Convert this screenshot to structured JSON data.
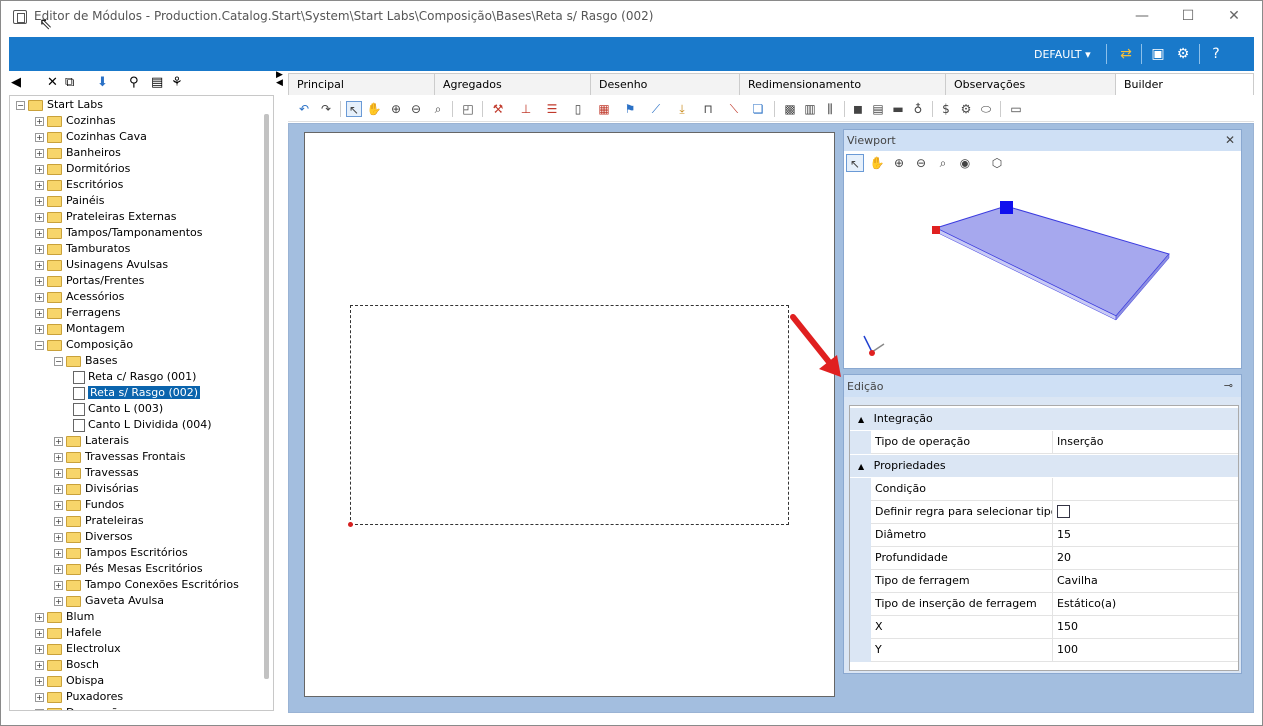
{
  "window": {
    "title": "Editor de Módulos - Production.Catalog.Start\\System\\Start Labs\\Composição\\Bases\\Reta s/ Rasgo (002)",
    "minimize": "—",
    "maximize": "☐",
    "close": "✕"
  },
  "topbar": {
    "profile_label": "DEFAULT",
    "dropdown_arrow": "▾",
    "accent_color": "#1979ca"
  },
  "tree": {
    "items": [
      {
        "label": "Start Labs",
        "type": "folder",
        "expander": "−"
      },
      {
        "label": "Cozinhas",
        "type": "folder",
        "expander": "+"
      },
      {
        "label": "Cozinhas Cava",
        "type": "folder",
        "expander": "+"
      },
      {
        "label": "Banheiros",
        "type": "folder",
        "expander": "+"
      },
      {
        "label": "Dormitórios",
        "type": "folder",
        "expander": "+"
      },
      {
        "label": "Escritórios",
        "type": "folder",
        "expander": "+"
      },
      {
        "label": "Painéis",
        "type": "folder",
        "expander": "+"
      },
      {
        "label": "Prateleiras Externas",
        "type": "folder",
        "expander": "+"
      },
      {
        "label": "Tampos/Tamponamentos",
        "type": "folder",
        "expander": "+"
      },
      {
        "label": "Tamburatos",
        "type": "folder",
        "expander": "+"
      },
      {
        "label": "Usinagens Avulsas",
        "type": "folder",
        "expander": "+"
      },
      {
        "label": "Portas/Frentes",
        "type": "folder",
        "expander": "+"
      },
      {
        "label": "Acessórios",
        "type": "folder",
        "expander": "+"
      },
      {
        "label": "Ferragens",
        "type": "folder",
        "expander": "+"
      },
      {
        "label": "Montagem",
        "type": "folder",
        "expander": "+"
      },
      {
        "label": "Composição",
        "type": "folder",
        "expander": "−"
      },
      {
        "label": "Bases",
        "type": "folder",
        "expander": "−"
      },
      {
        "label": "Reta c/ Rasgo (001)",
        "type": "doc",
        "expander": ""
      },
      {
        "label": "Reta s/ Rasgo (002)",
        "type": "doc",
        "expander": "",
        "selected": true
      },
      {
        "label": "Canto L (003)",
        "type": "doc",
        "expander": ""
      },
      {
        "label": "Canto L Dividida (004)",
        "type": "doc",
        "expander": ""
      },
      {
        "label": "Laterais",
        "type": "folder",
        "expander": "+"
      },
      {
        "label": "Travessas Frontais",
        "type": "folder",
        "expander": "+"
      },
      {
        "label": "Travessas",
        "type": "folder",
        "expander": "+"
      },
      {
        "label": "Divisórias",
        "type": "folder",
        "expander": "+"
      },
      {
        "label": "Fundos",
        "type": "folder",
        "expander": "+"
      },
      {
        "label": "Prateleiras",
        "type": "folder",
        "expander": "+"
      },
      {
        "label": "Diversos",
        "type": "folder",
        "expander": "+"
      },
      {
        "label": "Tampos Escritórios",
        "type": "folder",
        "expander": "+"
      },
      {
        "label": "Pés Mesas Escritórios",
        "type": "folder",
        "expander": "+"
      },
      {
        "label": "Tampo Conexões Escritórios",
        "type": "folder",
        "expander": "+"
      },
      {
        "label": "Gaveta Avulsa",
        "type": "folder",
        "expander": "+"
      },
      {
        "label": "Blum",
        "type": "folder",
        "expander": "+"
      },
      {
        "label": "Hafele",
        "type": "folder",
        "expander": "+"
      },
      {
        "label": "Electrolux",
        "type": "folder",
        "expander": "+"
      },
      {
        "label": "Bosch",
        "type": "folder",
        "expander": "+"
      },
      {
        "label": "Obispa",
        "type": "folder",
        "expander": "+"
      },
      {
        "label": "Puxadores",
        "type": "folder",
        "expander": "+"
      },
      {
        "label": "Decoração",
        "type": "folder",
        "expander": "+"
      }
    ]
  },
  "tabs": [
    {
      "label": "Principal",
      "active": false
    },
    {
      "label": "Agregados",
      "active": false
    },
    {
      "label": "Desenho",
      "active": false
    },
    {
      "label": "Redimensionamento",
      "active": false
    },
    {
      "label": "Observações",
      "active": false
    },
    {
      "label": "Builder",
      "active": true
    }
  ],
  "viewport": {
    "title": "Viewport",
    "close": "✕"
  },
  "edicao": {
    "title": "Edição",
    "pin": "📌",
    "categories": [
      {
        "label": "Integração",
        "toggle": "▲"
      },
      {
        "label": "Propriedades",
        "toggle": "▲"
      }
    ],
    "rows": [
      {
        "name": "Tipo de operação",
        "value": "Inserção"
      },
      {
        "name": "Condição",
        "value": ""
      },
      {
        "name": "Definir regra para selecionar tipo...",
        "value": "",
        "checkbox": true
      },
      {
        "name": "Diâmetro",
        "value": "15"
      },
      {
        "name": "Profundidade",
        "value": "20"
      },
      {
        "name": "Tipo de ferragem",
        "value": "Cavilha"
      },
      {
        "name": "Tipo de inserção de ferragem",
        "value": "Estático(a)"
      },
      {
        "name": "X",
        "value": "150"
      },
      {
        "name": "Y",
        "value": "100"
      }
    ]
  }
}
